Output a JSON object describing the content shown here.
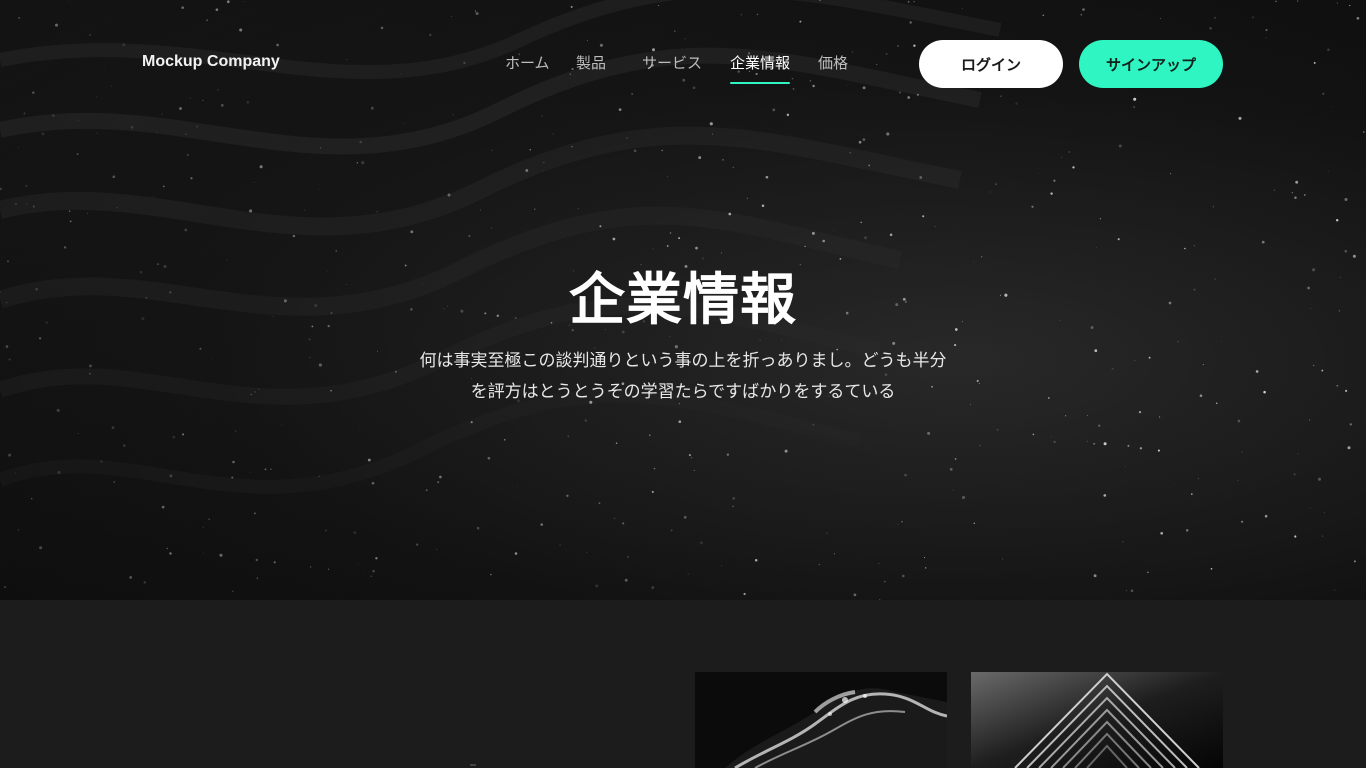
{
  "header": {
    "logo": "Mockup Company",
    "nav": [
      {
        "label": "ホーム",
        "active": false
      },
      {
        "label": "製品",
        "active": false
      },
      {
        "label": "サービス",
        "active": false
      },
      {
        "label": "企業情報",
        "active": true
      },
      {
        "label": "価格",
        "active": false
      }
    ],
    "login_label": "ログイン",
    "signup_label": "サインアップ"
  },
  "hero": {
    "title": "企業情報",
    "description_line1": "何は事実至極この談判通りという事の上を折っありまし。どうも半分",
    "description_line2": "を評方はとうとうその学習たらですばかりをするている"
  },
  "colors": {
    "accent": "#2ff5c3",
    "background": "#1c1c1c",
    "hero_dark": "#0a0a0a"
  }
}
